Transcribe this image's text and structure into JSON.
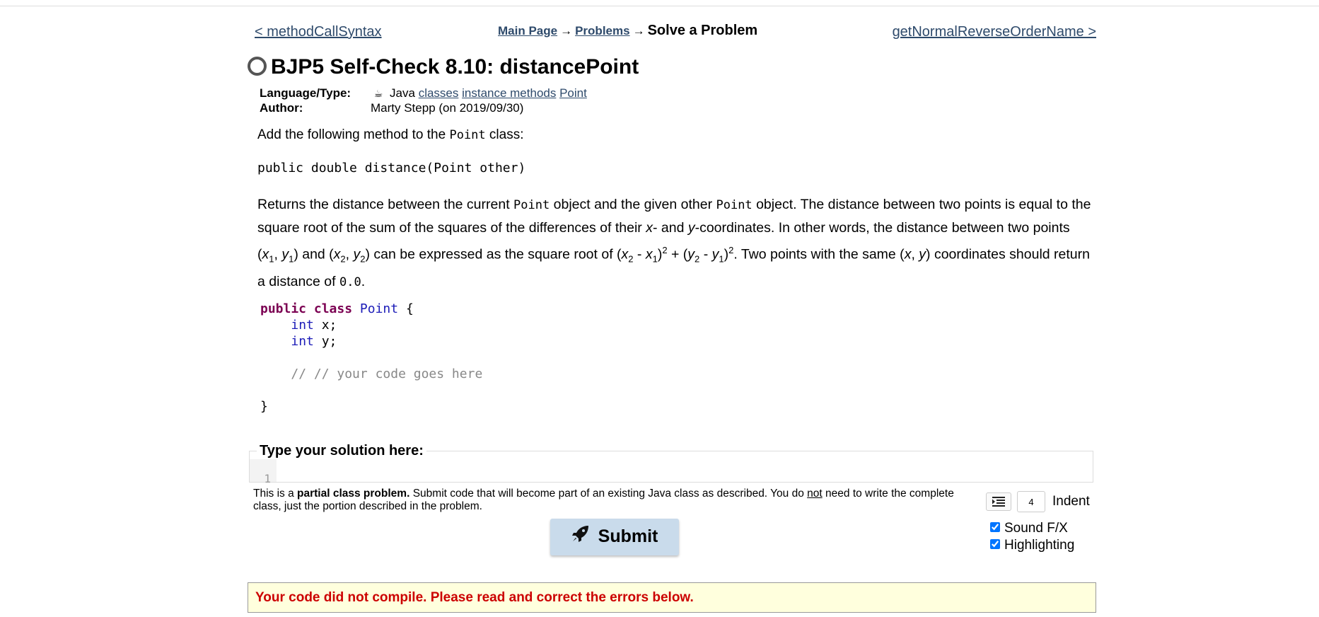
{
  "nav": {
    "prev_label": "< methodCallSyntax",
    "next_label": "getNormalReverseOrderName >",
    "breadcrumb": {
      "main": "Main Page",
      "arrow": "→",
      "problems": "Problems",
      "current": "Solve a Problem"
    }
  },
  "problem": {
    "title": "BJP5 Self-Check 8.10: distancePoint",
    "language_label": "Language/Type:",
    "language": "Java",
    "tags": [
      "classes",
      "instance methods",
      "Point"
    ],
    "author_label": "Author:",
    "author": "Marty Stepp (on 2019/09/30)"
  },
  "description": {
    "intro_pre": "Add the following method to the ",
    "intro_code": "Point",
    "intro_post": " class:",
    "signature": "public double distance(Point other)",
    "p1_a": "Returns the distance between the current ",
    "p1_code1": "Point",
    "p1_b": " object and the given other ",
    "p1_code2": "Point",
    "p1_c": " object. The distance between two points is equal to the square root of the sum of the squares of the differences of their ",
    "x": "x",
    "p1_d": "- and ",
    "y": "y",
    "p1_e": "-coordinates. In other words, the distance between two points (",
    "sub1": "1",
    "sub2": "2",
    "sup2": "2",
    "p1_f": ") can be expressed as the square root of (",
    "p1_g": ". Two points with the same (",
    "p1_h": ") coordinates should return a distance of ",
    "p1_code3": "0.0",
    "p1_end": "."
  },
  "code_skeleton": {
    "kw_public": "public",
    "kw_class": "class",
    "class_name": "Point",
    "brace_open": "{",
    "type_int": "int",
    "field_x": "x;",
    "field_y": "y;",
    "comment": "// // your code goes here",
    "brace_close": "}"
  },
  "editor": {
    "legend": "Type your solution here:",
    "line_number": "1"
  },
  "partial_note": {
    "pre": "This is a ",
    "bold": "partial class problem.",
    "mid": " Submit code that will become part of an existing Java class as described. You do ",
    "underline": "not",
    "post": " need to write the complete class, just the portion described in the problem."
  },
  "controls": {
    "indent_value": "4",
    "indent_label": "Indent",
    "sound_label": "Sound F/X",
    "highlight_label": "Highlighting",
    "sound_checked": true,
    "highlight_checked": true
  },
  "submit_label": "Submit",
  "error_message": "Your code did not compile. Please read and correct the errors below."
}
